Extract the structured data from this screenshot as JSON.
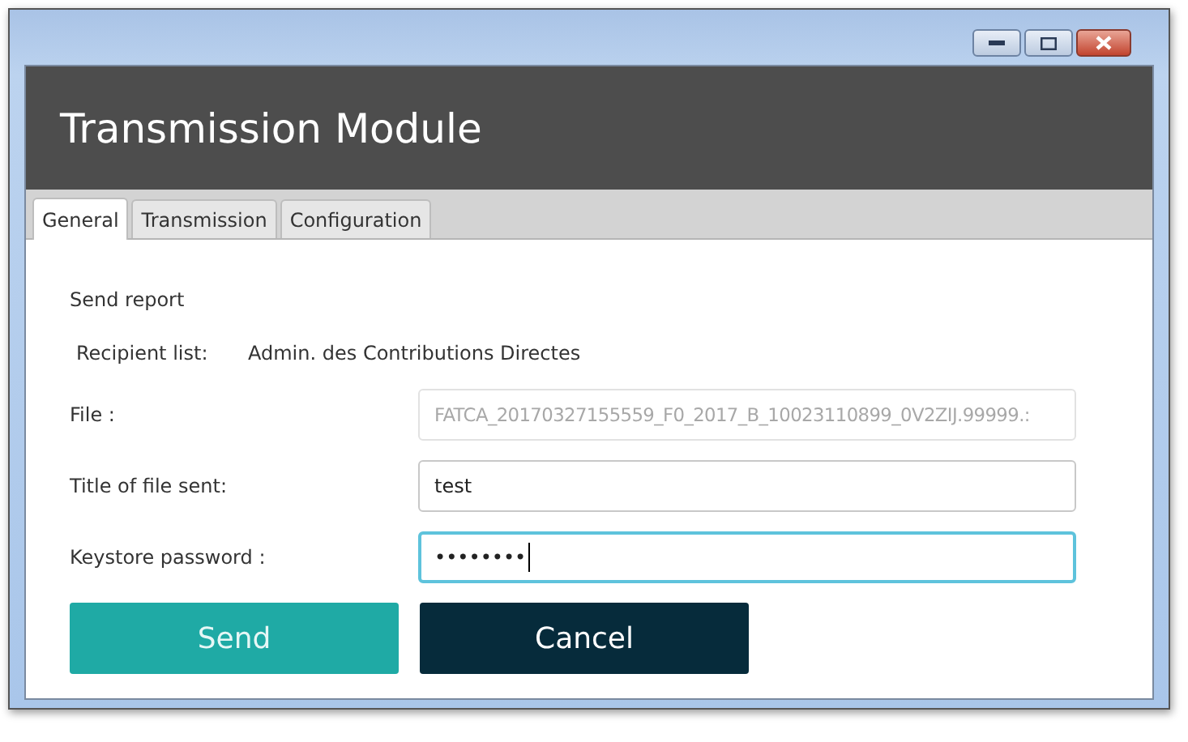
{
  "window": {
    "title": "Transmission Module"
  },
  "tabs": [
    {
      "label": "General",
      "selected": true
    },
    {
      "label": "Transmission",
      "selected": false
    },
    {
      "label": "Configuration",
      "selected": false
    }
  ],
  "section_title": "Send report",
  "recipient": {
    "label": "Recipient list:",
    "value": "Admin. des Contributions Directes"
  },
  "fields": [
    {
      "label": "File :",
      "value": "FATCA_20170327155559_F0_2017_B_10023110899_0V2ZIJ.99999.:",
      "disabled": true,
      "focused": false
    },
    {
      "label": "Title of file sent:",
      "value": "test",
      "disabled": false,
      "focused": false
    },
    {
      "label": "Keystore password :",
      "value": "••••••••",
      "disabled": false,
      "focused": true
    }
  ],
  "buttons": [
    {
      "label": "Send",
      "kind": "primary"
    },
    {
      "label": "Cancel",
      "kind": "secondary"
    }
  ]
}
